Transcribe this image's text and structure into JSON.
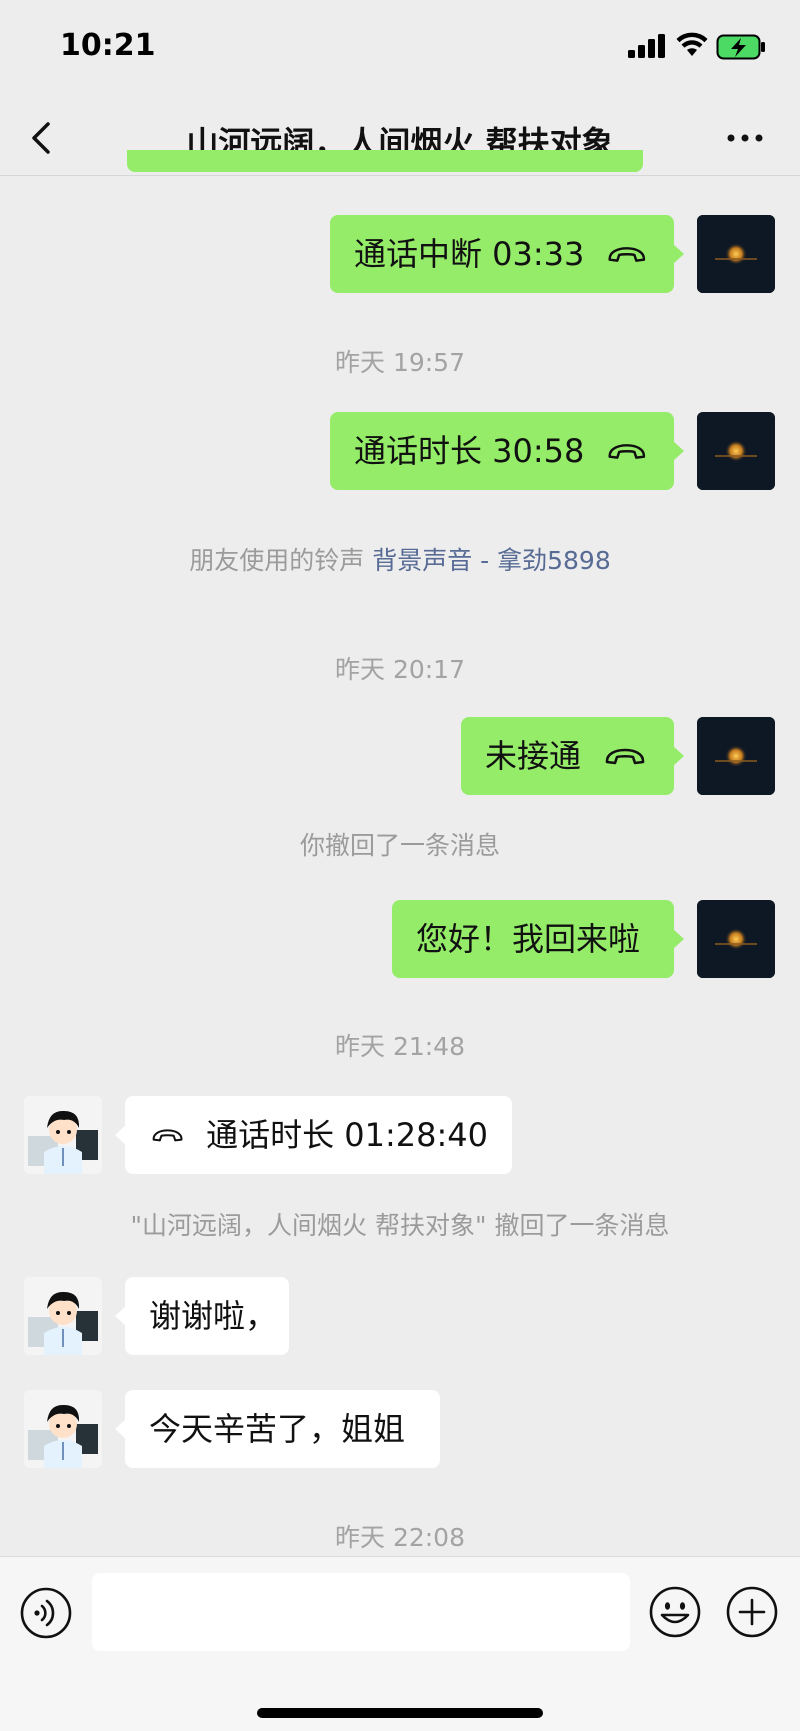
{
  "status_bar": {
    "time": "10:21"
  },
  "header": {
    "title": "山河远阔，人间烟火 帮扶对象"
  },
  "messages": [
    {
      "type": "call",
      "from": "me",
      "text": "通话中断 03:33"
    },
    {
      "type": "timestamp",
      "text": "昨天 19:57"
    },
    {
      "type": "call",
      "from": "me",
      "text": "通话时长 30:58"
    },
    {
      "type": "system",
      "text": "朋友使用的铃声",
      "link": "背景声音 - 拿劲5898"
    },
    {
      "type": "timestamp",
      "text": "昨天 20:17"
    },
    {
      "type": "call",
      "from": "me",
      "text": "未接通"
    },
    {
      "type": "system",
      "text": "你撤回了一条消息"
    },
    {
      "type": "text",
      "from": "me",
      "text": "您好！我回来啦"
    },
    {
      "type": "timestamp",
      "text": "昨天 21:48"
    },
    {
      "type": "call",
      "from": "them",
      "text": "通话时长 01:28:40"
    },
    {
      "type": "system",
      "text": "\"山河远阔，人间烟火 帮扶对象\" 撤回了一条消息"
    },
    {
      "type": "text",
      "from": "them",
      "text": "谢谢啦，"
    },
    {
      "type": "text",
      "from": "them",
      "text": "今天辛苦了，姐姐"
    },
    {
      "type": "timestamp",
      "text": "昨天 22:08"
    }
  ],
  "input": {
    "value": "",
    "placeholder": ""
  },
  "colors": {
    "bubble_me": "#95ec69",
    "bubble_them": "#ffffff",
    "background": "#ededed",
    "link": "#576b95",
    "battery": "#4cd964"
  },
  "icons": [
    "back-chevron-icon",
    "more-dots-icon",
    "phone-hangup-icon",
    "voice-icon",
    "emoji-icon",
    "plus-icon",
    "signal-icon",
    "wifi-icon",
    "battery-icon"
  ]
}
